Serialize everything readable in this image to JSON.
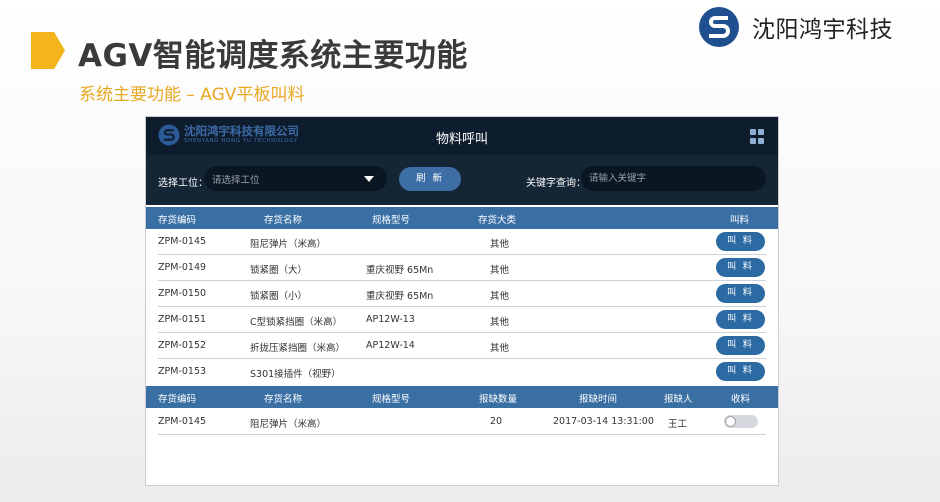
{
  "slide": {
    "title": "AGV智能调度系统主要功能",
    "subtitle": "系统主要功能 – AGV平板叫料",
    "brand_name": "沈阳鸿宇科技",
    "accent_color": "#f3b51b"
  },
  "app": {
    "company_name": "沈阳鸿宇科技有限公司",
    "company_name_en": "SHENYANG HONG YU TECHNOLOGY",
    "title": "物料呼叫",
    "menu_icon": "grid-menu-icon",
    "toolbar": {
      "station_label": "选择工位：",
      "station_placeholder": "请选择工位",
      "refresh_label": "刷 新",
      "keyword_label": "关键字查询：",
      "keyword_placeholder": "请输入关键字"
    },
    "materials_table": {
      "headers": {
        "code": "存货编码",
        "name": "存货名称",
        "spec": "规格型号",
        "category": "存货大类",
        "call": "叫料"
      },
      "call_button_label": "叫 料",
      "rows": [
        {
          "code": "ZPM-0145",
          "name": "阻尼弹片（米高）",
          "spec": "",
          "category": "其他"
        },
        {
          "code": "ZPM-0149",
          "name": "锁紧圈（大）",
          "spec": "重庆视野 65Mn",
          "category": "其他"
        },
        {
          "code": "ZPM-0150",
          "name": "锁紧圈（小）",
          "spec": "重庆视野 65Mn",
          "category": "其他"
        },
        {
          "code": "ZPM-0151",
          "name": "C型锁紧挡圈（米高）",
          "spec": "AP12W-13",
          "category": "其他"
        },
        {
          "code": "ZPM-0152",
          "name": "折拢压紧挡圈（米高）",
          "spec": "AP12W-14",
          "category": "其他"
        },
        {
          "code": "ZPM-0153",
          "name": "S301接插件（视野）",
          "spec": "",
          "category": ""
        }
      ]
    },
    "requests_table": {
      "headers": {
        "code": "存货编码",
        "name": "存货名称",
        "spec": "规格型号",
        "quantity": "报缺数量",
        "time": "报缺时间",
        "reporter": "报缺人",
        "receive": "收料"
      },
      "rows": [
        {
          "code": "ZPM-0145",
          "name": "阻尼弹片（米高）",
          "spec": "",
          "quantity": "20",
          "time": "2017-03-14 13:31:00",
          "reporter": "王工",
          "received": false
        }
      ]
    }
  }
}
